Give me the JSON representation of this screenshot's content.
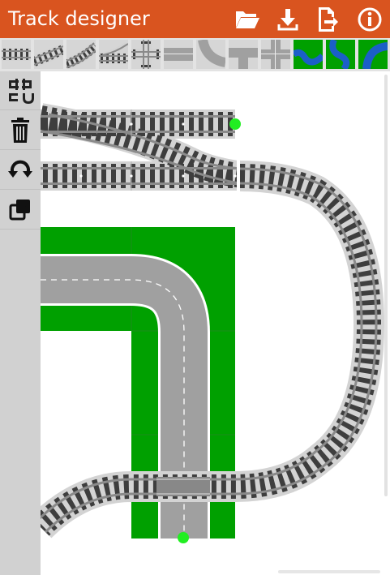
{
  "app": {
    "title": "Track designer"
  },
  "toolbar": {
    "buttons": [
      {
        "name": "open-file-button",
        "icon": "folder-open-icon"
      },
      {
        "name": "download-button",
        "icon": "download-icon"
      },
      {
        "name": "export-button",
        "icon": "export-icon"
      },
      {
        "name": "info-button",
        "icon": "info-icon"
      }
    ]
  },
  "palette": {
    "pieces": [
      "straight-track",
      "curved-track",
      "long-curve-track",
      "switch-track",
      "crossing-track",
      "straight-road",
      "curved-road",
      "road-t-junction",
      "road-crossroads",
      "river-bend",
      "river-curve",
      "river-corner"
    ]
  },
  "sidebar": {
    "tools": [
      {
        "name": "align-tool",
        "icon": "align-icon"
      },
      {
        "name": "delete-tool",
        "icon": "trash-icon"
      },
      {
        "name": "rotate-tool",
        "icon": "rotate-icon"
      },
      {
        "name": "duplicate-tool",
        "icon": "copy-icon"
      }
    ]
  },
  "colors": {
    "titlebar": "#d9541f",
    "grass": "#00a000",
    "road": "#a0a0a0",
    "rail_bed": "#d3d3d3",
    "rail": "#8a8a8a",
    "sleeper": "#3e3e3e",
    "connector": "#22ee22",
    "river_water": "#1b5fc8"
  }
}
